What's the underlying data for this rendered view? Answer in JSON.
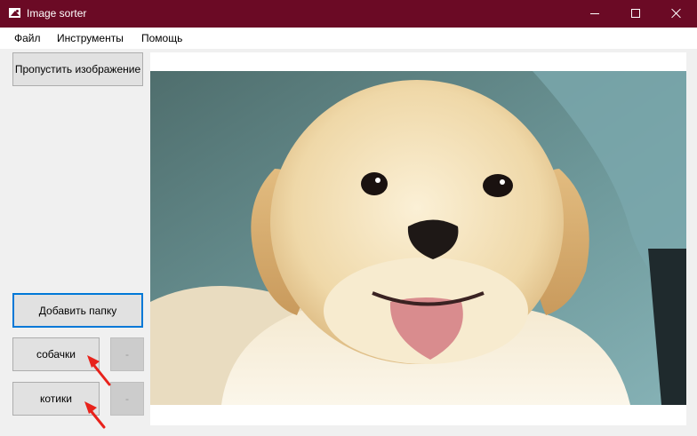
{
  "window": {
    "title": "Image sorter",
    "app_icon": "image-icon",
    "controls": [
      "minimize-icon",
      "maximize-icon",
      "close-icon"
    ]
  },
  "menu": {
    "items": [
      "Файл",
      "Инструменты",
      "Помощь"
    ]
  },
  "sidebar": {
    "skip_button": "Пропустить изображение",
    "add_folder_button": "Добавить папку",
    "folders": [
      {
        "label": "собачки",
        "remove_label": "-"
      },
      {
        "label": "котики",
        "remove_label": "-"
      }
    ]
  },
  "viewer": {
    "image": "labrador-puppy-photo"
  },
  "colors": {
    "titlebar": "#6b0a25",
    "focus_border": "#0078d7",
    "annotation_arrow": "#e8221b"
  }
}
